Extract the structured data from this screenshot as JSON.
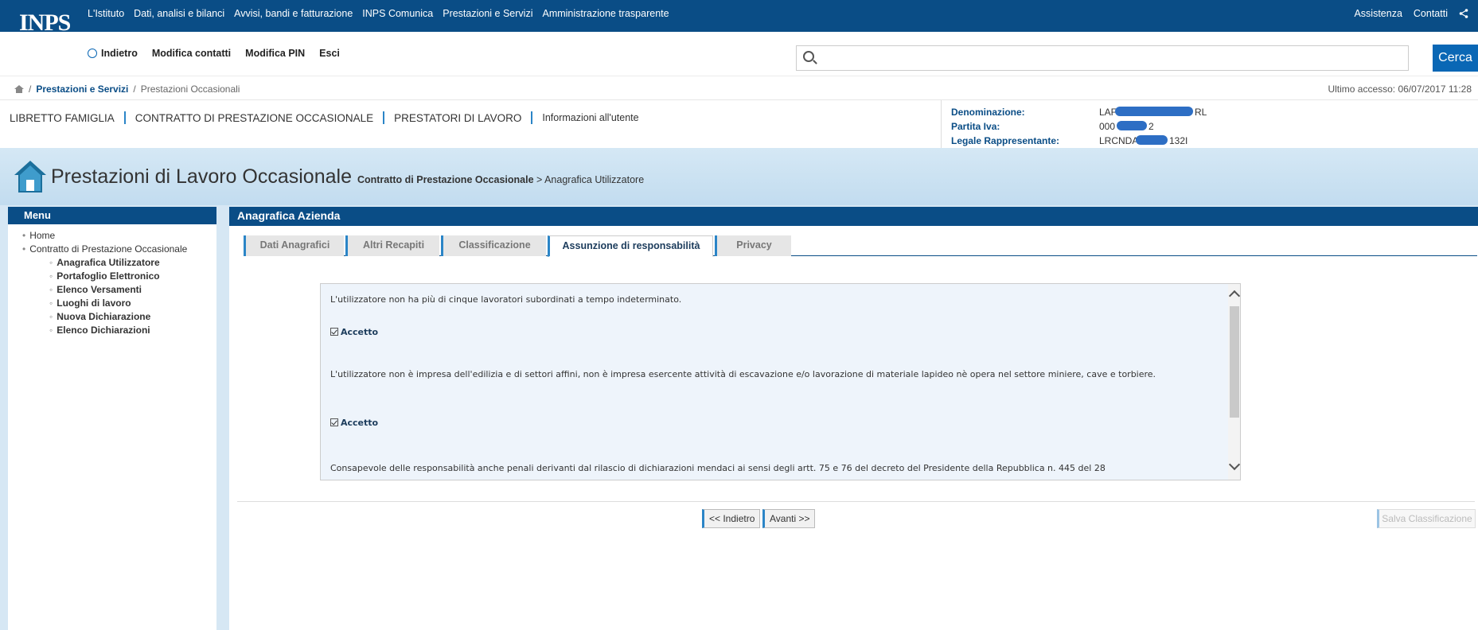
{
  "header": {
    "logo_text": "INPS",
    "top_links": [
      "L'Istituto",
      "Dati, analisi e bilanci",
      "Avvisi, bandi e fatturazione",
      "INPS Comunica",
      "Prestazioni e Servizi",
      "Amministrazione trasparente"
    ],
    "assistenza": "Assistenza",
    "contatti": "Contatti",
    "nav": {
      "indietro": "Indietro",
      "modifica_contatti": "Modifica contatti",
      "modifica_pin": "Modifica PIN",
      "esci": "Esci"
    },
    "search": {
      "placeholder": "",
      "button": "Cerca"
    }
  },
  "breadcrumb": {
    "section": "Prestazioni e Servizi",
    "page": "Prestazioni Occasionali",
    "last_access": "Ultimo accesso: 06/07/2017 11:28"
  },
  "service_nav": [
    "LIBRETTO FAMIGLIA",
    "CONTRATTO DI PRESTAZIONE OCCASIONALE",
    "PRESTATORI DI LAVORO",
    "Informazioni all'utente"
  ],
  "info": {
    "denominazione_label": "Denominazione:",
    "denominazione_value_a": "LAF",
    "denominazione_value_b": "RL",
    "partita_iva_label": "Partita Iva:",
    "partita_iva_value_a": "000",
    "partita_iva_value_b": "2",
    "legale_label": "Legale Rappresentante:",
    "legale_value_a": "LRCNDA",
    "legale_value_b": "132I"
  },
  "banner": {
    "title": "Prestazioni di Lavoro Occasionale",
    "sub_bold": "Contratto di Prestazione Occasionale",
    "sub_rest": " > Anagrafica Utilizzatore"
  },
  "menu": {
    "title": "Menu",
    "items": [
      "Home",
      "Contratto di Prestazione Occasionale"
    ],
    "subitems": [
      "Anagrafica Utilizzatore",
      "Portafoglio Elettronico",
      "Elenco Versamenti",
      "Luoghi di lavoro",
      "Nuova Dichiarazione",
      "Elenco Dichiarazioni"
    ]
  },
  "panel": {
    "title": "Anagrafica Azienda",
    "tabs": [
      "Dati Anagrafici",
      "Altri Recapiti",
      "Classificazione",
      "Assunzione di responsabilità",
      "Privacy"
    ],
    "active_tab": "Assunzione di responsabilità",
    "statements": [
      "L'utilizzatore non ha più di cinque lavoratori subordinati a tempo indeterminato.",
      "L'utilizzatore non è impresa dell'edilizia e di settori affini, non è impresa esercente attività di escavazione e/o lavorazione di materiale lapideo nè opera nel settore miniere, cave e torbiere.",
      "Consapevole delle responsabilità anche penali derivanti dal rilascio di dichiarazioni mendaci ai sensi degli artt. 75 e 76 del decreto del Presidente della Repubblica n. 445 del 28"
    ],
    "accept_label": "Accetto",
    "buttons": {
      "back": "<< Indietro",
      "next": "Avanti >>",
      "save": "Salva Classificazione"
    }
  },
  "colors": {
    "primary": "#0a4d86",
    "accent": "#2b85c7",
    "banner": "#d5e8f5"
  }
}
